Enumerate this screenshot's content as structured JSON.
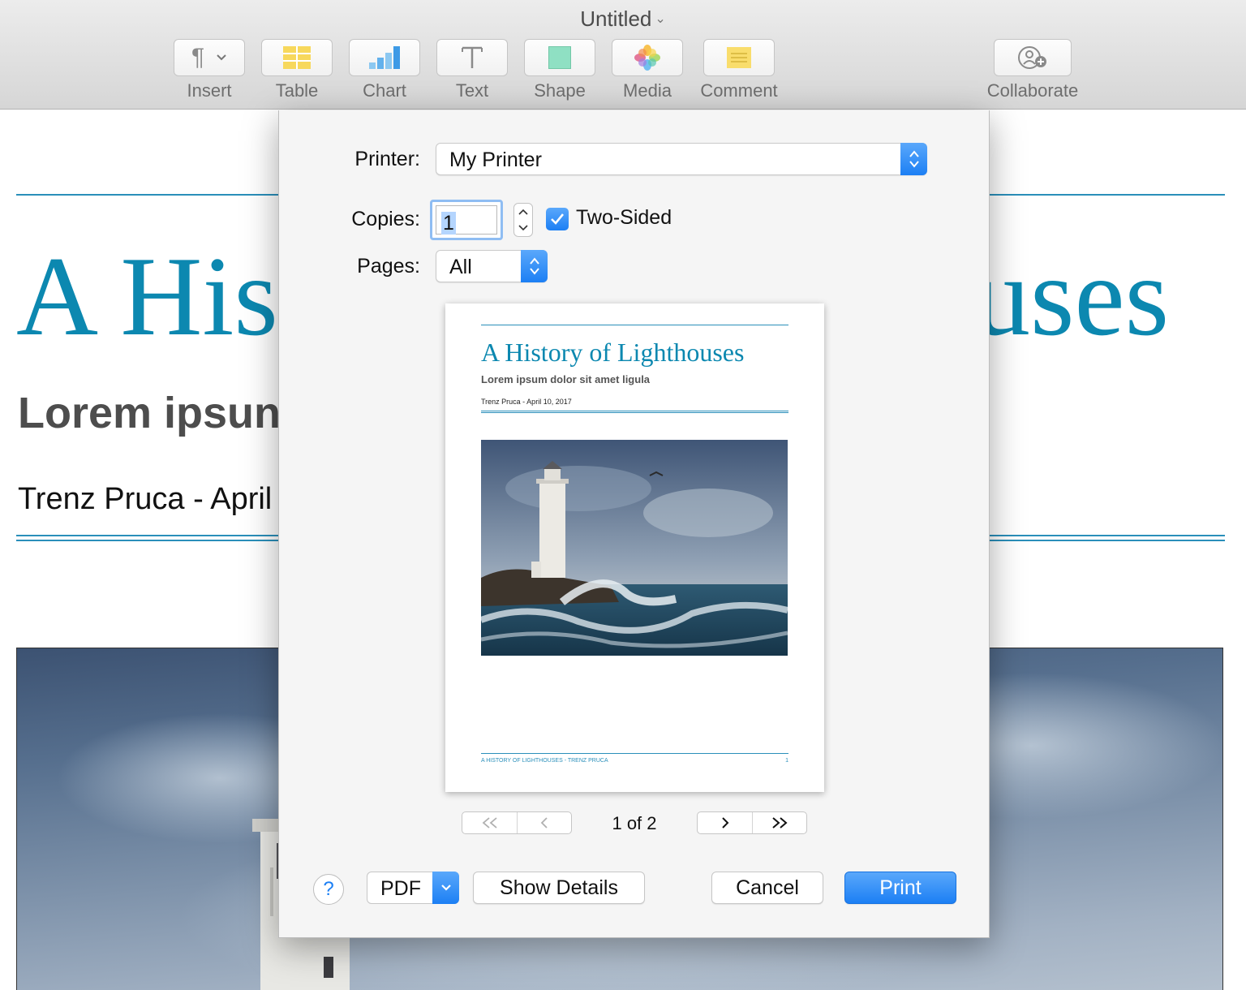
{
  "window": {
    "title": "Untitled"
  },
  "toolbar": {
    "items": [
      {
        "label": "Insert",
        "icon": "paragraph-icon"
      },
      {
        "label": "Table",
        "icon": "table-icon"
      },
      {
        "label": "Chart",
        "icon": "chart-icon"
      },
      {
        "label": "Text",
        "icon": "text-icon"
      },
      {
        "label": "Shape",
        "icon": "shape-icon"
      },
      {
        "label": "Media",
        "icon": "photos-icon"
      },
      {
        "label": "Comment",
        "icon": "comment-icon"
      },
      {
        "label": "Collaborate",
        "icon": "collaborate-icon"
      }
    ]
  },
  "document": {
    "title_visible_left": "A His",
    "title_visible_right": "uses",
    "subtitle_visible": "Lorem ipsun",
    "author_visible": "Trenz Pruca - April"
  },
  "print_dialog": {
    "printer_label": "Printer:",
    "printer_value": "My Printer",
    "copies_label": "Copies:",
    "copies_value": "1",
    "two_sided_label": "Two-Sided",
    "two_sided_checked": true,
    "pages_label": "Pages:",
    "pages_value": "All",
    "preview": {
      "title": "A History of Lighthouses",
      "subtitle": "Lorem ipsum dolor sit amet ligula",
      "author": "Trenz Pruca - April 10, 2017",
      "footer": "A HISTORY OF LIGHTHOUSES - TRENZ PRUCA",
      "page_number": "1"
    },
    "page_indicator": "1 of 2",
    "help_label": "?",
    "pdf_label": "PDF",
    "show_details_label": "Show Details",
    "cancel_label": "Cancel",
    "print_label": "Print"
  },
  "colors": {
    "accent": "#1c7ff4",
    "title_blue": "#0c88b0",
    "rule_blue": "#2a8fba"
  }
}
